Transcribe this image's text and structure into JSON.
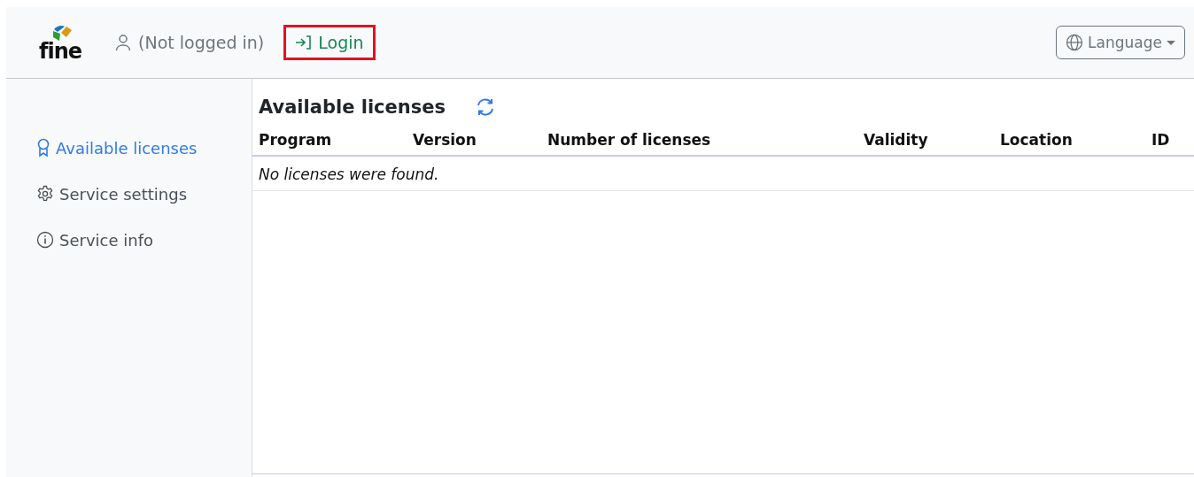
{
  "header": {
    "logo_text": "fine",
    "user_status": "(Not logged in)",
    "login": {
      "label": "Login",
      "highlighted": true
    },
    "language_button": "Language"
  },
  "sidebar": {
    "items": [
      {
        "label": "Available licenses",
        "kind": "licenses",
        "selected": true
      },
      {
        "label": "Service settings",
        "kind": "settings",
        "selected": false
      },
      {
        "label": "Service info",
        "kind": "info",
        "selected": false
      }
    ]
  },
  "main": {
    "title": "Available licenses",
    "table": {
      "columns": [
        "Program",
        "Version",
        "Number of licenses",
        "Validity",
        "Location",
        "ID"
      ],
      "empty_message": "No licenses were found."
    }
  }
}
